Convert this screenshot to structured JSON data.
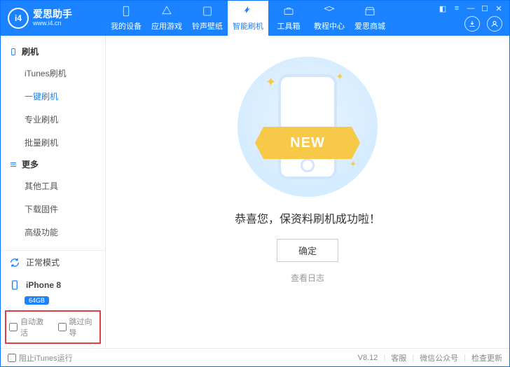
{
  "brand": {
    "logo_text": "i4",
    "title": "爱思助手",
    "subtitle": "www.i4.cn"
  },
  "top_tabs": [
    {
      "label": "我的设备",
      "icon": "phone-icon"
    },
    {
      "label": "应用游戏",
      "icon": "apps-icon"
    },
    {
      "label": "铃声壁纸",
      "icon": "music-icon"
    },
    {
      "label": "智能刷机",
      "icon": "flash-icon",
      "active": true
    },
    {
      "label": "工具箱",
      "icon": "toolbox-icon"
    },
    {
      "label": "教程中心",
      "icon": "tutorial-icon"
    },
    {
      "label": "爱思商城",
      "icon": "store-icon"
    }
  ],
  "sidebar": {
    "group1": {
      "title": "刷机",
      "items": [
        {
          "label": "iTunes刷机"
        },
        {
          "label": "一键刷机",
          "active": true
        },
        {
          "label": "专业刷机"
        },
        {
          "label": "批量刷机"
        }
      ]
    },
    "group2": {
      "title": "更多",
      "items": [
        {
          "label": "其他工具"
        },
        {
          "label": "下载固件"
        },
        {
          "label": "高级功能"
        }
      ]
    },
    "mode": "正常模式",
    "device": {
      "name": "iPhone 8",
      "storage": "64GB"
    },
    "options": {
      "auto_activate": "自动激活",
      "skip_guide": "跳过向导"
    }
  },
  "main": {
    "ribbon": "NEW",
    "message": "恭喜您，保资料刷机成功啦！",
    "ok": "确定",
    "log_link": "查看日志"
  },
  "footer": {
    "block_itunes": "阻止iTunes运行",
    "version": "V8.12",
    "support": "客服",
    "wechat": "微信公众号",
    "update": "检查更新"
  }
}
